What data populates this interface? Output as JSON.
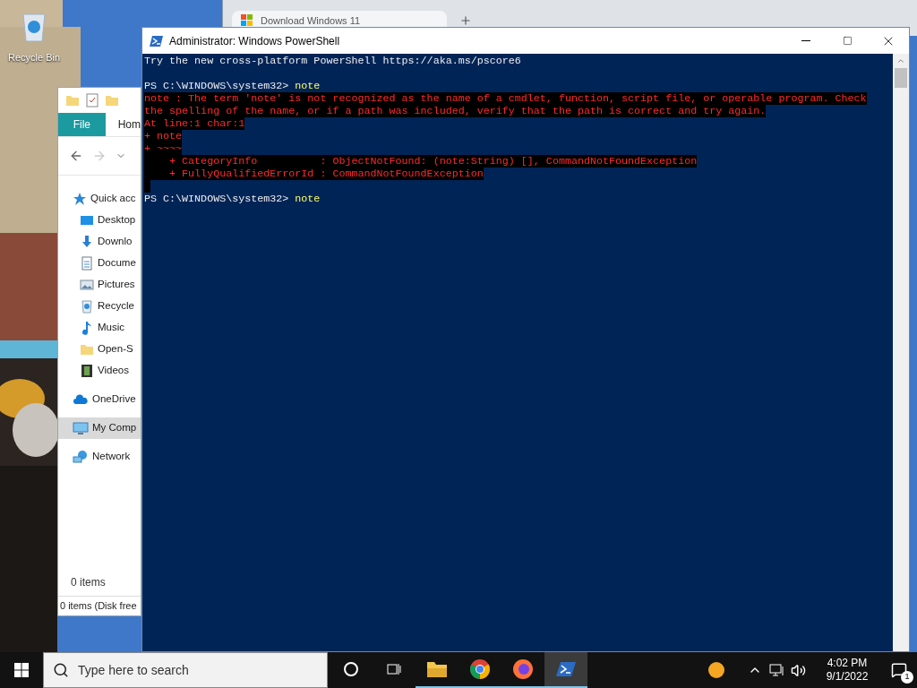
{
  "desktop_icons": [
    {
      "label": "Recycle Bin"
    }
  ],
  "browser": {
    "tab": {
      "title": "Download Windows 11"
    }
  },
  "explorer": {
    "ribbon_tabs": [
      {
        "label": "File",
        "selected": true
      },
      {
        "label": "Hom",
        "selected": false
      }
    ],
    "tree": [
      {
        "label": "Quick acc",
        "selected": false,
        "children": [
          {
            "label": "Desktop",
            "selected": false
          },
          {
            "label": "Downlo",
            "selected": false
          },
          {
            "label": "Docume",
            "selected": false
          },
          {
            "label": "Pictures",
            "selected": false
          },
          {
            "label": "Recycle",
            "selected": false
          },
          {
            "label": "Music",
            "selected": false
          },
          {
            "label": "Open-S",
            "selected": false
          },
          {
            "label": "Videos",
            "selected": false
          }
        ]
      },
      {
        "label": "OneDrive",
        "selected": false
      },
      {
        "label": "My Comp",
        "selected": true
      },
      {
        "label": "Network",
        "selected": false
      }
    ],
    "item_count": "0 items",
    "status_bar": "0 items (Disk free"
  },
  "powershell": {
    "title": "Administrator: Windows PowerShell",
    "lines": [
      {
        "kind": "output",
        "text": "Try the new cross-platform PowerShell https://aka.ms/pscore6"
      },
      {
        "kind": "blank"
      },
      {
        "kind": "prompt",
        "prompt": "PS C:\\WINDOWS\\system32>",
        "command": "note"
      },
      {
        "kind": "error",
        "text": "note : The term 'note' is not recognized as the name of a cmdlet, function, script file, or operable program. Check"
      },
      {
        "kind": "error",
        "text": "the spelling of the name, or if a path was included, verify that the path is correct and try again."
      },
      {
        "kind": "error",
        "text": "At line:1 char:1"
      },
      {
        "kind": "error",
        "text": "+ note"
      },
      {
        "kind": "error",
        "text": "+ ~~~~"
      },
      {
        "kind": "error",
        "text": "    + CategoryInfo          : ObjectNotFound: (note:String) [], CommandNotFoundException"
      },
      {
        "kind": "error",
        "text": "    + FullyQualifiedErrorId : CommandNotFoundException"
      },
      {
        "kind": "error_blank"
      },
      {
        "kind": "prompt",
        "prompt": "PS C:\\WINDOWS\\system32>",
        "command": "note"
      }
    ]
  },
  "taskbar": {
    "search": {
      "placeholder": "Type here to search"
    },
    "apps": [
      {
        "kind": "cortana",
        "running": false,
        "selected": false
      },
      {
        "kind": "taskview",
        "running": false,
        "selected": false
      },
      {
        "kind": "explorer",
        "running": true,
        "selected": false
      },
      {
        "kind": "chrome",
        "running": true,
        "selected": false
      },
      {
        "kind": "firefox",
        "running": true,
        "selected": false
      },
      {
        "kind": "powershell",
        "running": true,
        "selected": true
      }
    ],
    "time": "4:02 PM",
    "date": "9/1/2022",
    "notification_count": "1"
  }
}
